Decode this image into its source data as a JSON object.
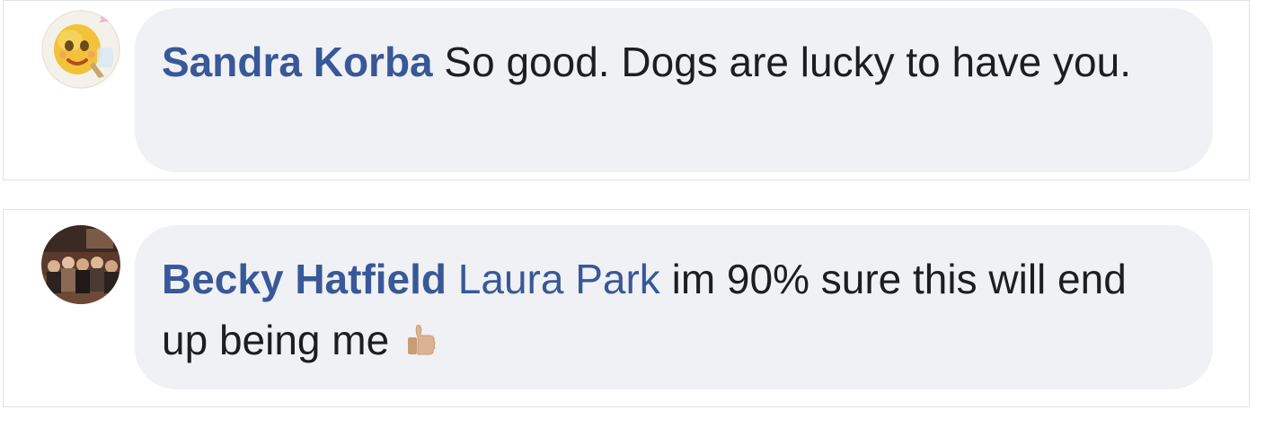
{
  "comments": [
    {
      "author": "Sandra Korba",
      "text": "So good. Dogs are lucky to have you.",
      "avatar": "emoji-face-avatar"
    },
    {
      "author": "Becky Hatfield",
      "mention": "Laura Park",
      "text": "im 90% sure this will end up being me",
      "emoji": "thumbs-up-icon",
      "avatar": "group-photo-avatar"
    }
  ],
  "colors": {
    "link": "#385898",
    "bubble": "#f0f1f4",
    "text": "#1c1e21"
  }
}
